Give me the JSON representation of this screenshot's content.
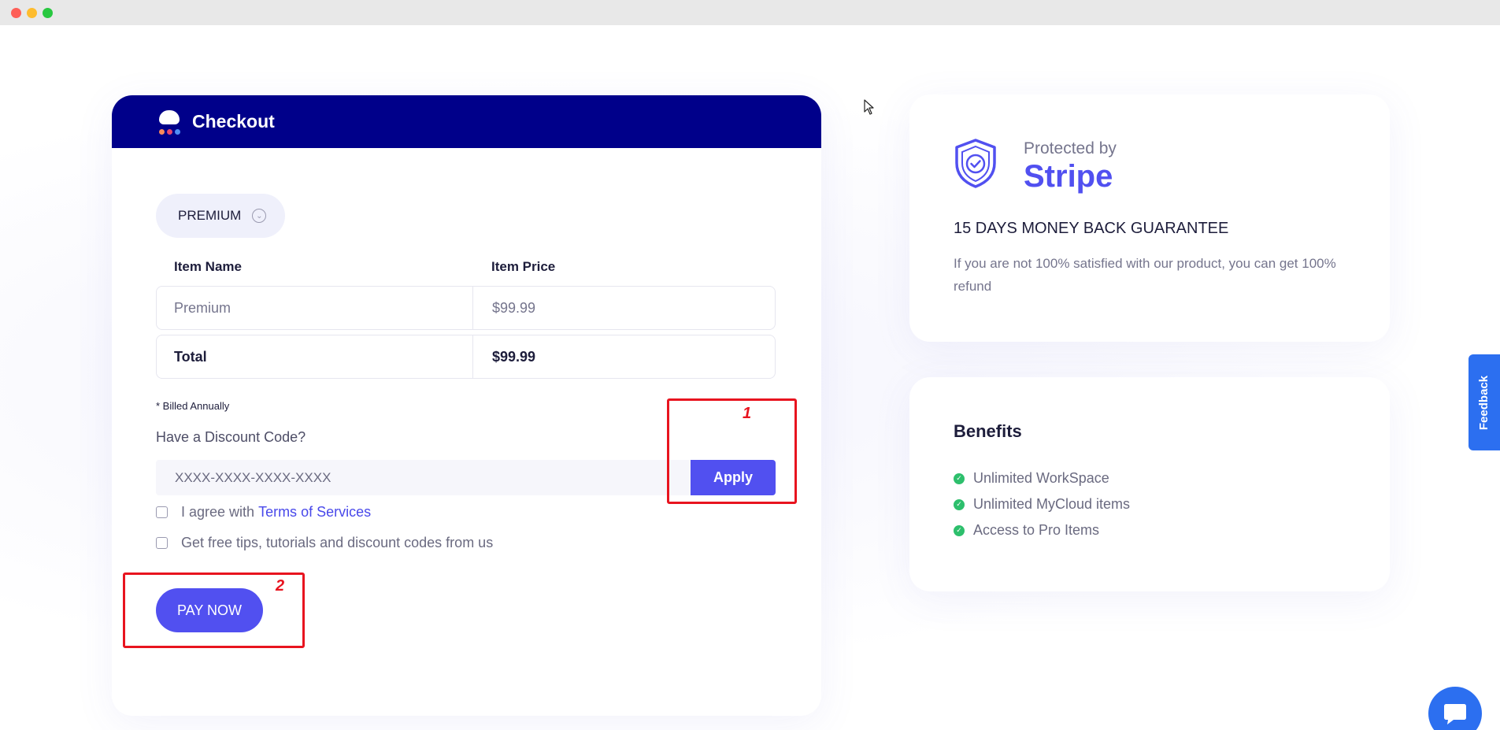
{
  "checkout": {
    "title": "Checkout",
    "plan_selected": "PREMIUM",
    "table": {
      "headers": [
        "Item Name",
        "Item Price"
      ],
      "rows": [
        {
          "name": "Premium",
          "price": "$99.99"
        },
        {
          "name": "Total",
          "price": "$99.99"
        }
      ]
    },
    "billed_note": "* Billed Annually",
    "discount_label": "Have a Discount Code?",
    "discount_placeholder": "XXXX-XXXX-XXXX-XXXX",
    "apply_label": "Apply",
    "agree_prefix": "I agree with",
    "terms_link": "Terms of Services",
    "tips_label": "Get free tips, tutorials and discount codes from us",
    "pay_label": "PAY NOW"
  },
  "annotations": [
    "1",
    "2"
  ],
  "stripe": {
    "protected_by": "Protected by",
    "brand": "Stripe",
    "guarantee": "15 DAYS MONEY BACK GUARANTEE",
    "refund_text": "If you are not 100% satisfied with our product, you can get 100% refund"
  },
  "benefits": {
    "title": "Benefits",
    "items": [
      "Unlimited WorkSpace",
      "Unlimited MyCloud items",
      "Access to Pro Items"
    ]
  },
  "feedback_label": "Feedback",
  "colors": {
    "header": "#00008a",
    "accent": "#5150f0",
    "annotation": "#e8141f",
    "success": "#2dbf6c",
    "widget": "#2c6ff0"
  }
}
